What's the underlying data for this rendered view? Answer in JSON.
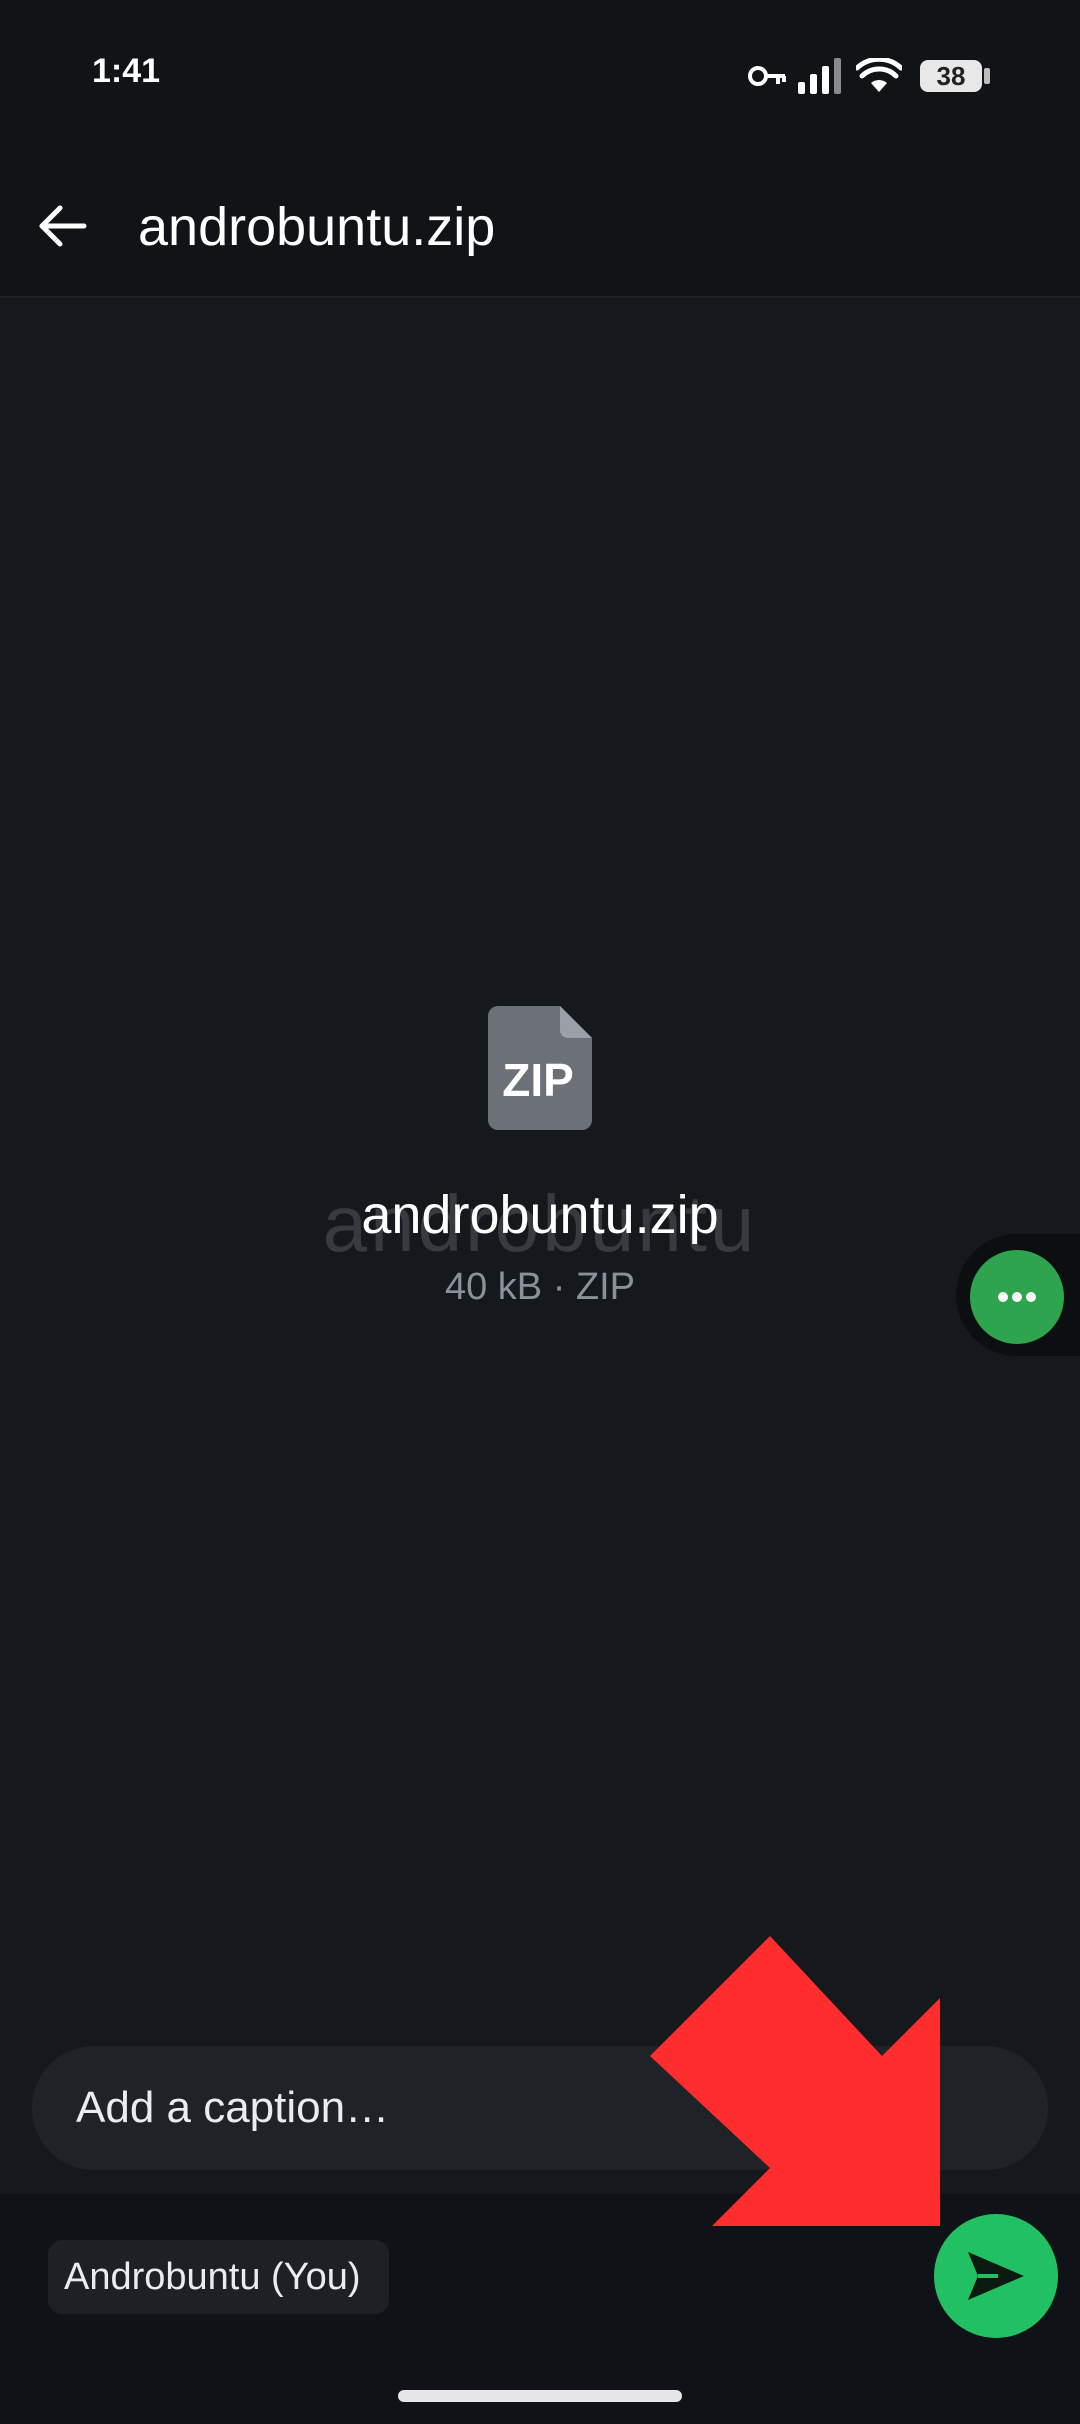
{
  "status_bar": {
    "time": "1:41",
    "battery": "38",
    "icons": [
      "key-icon",
      "signal-icon",
      "wifi-icon",
      "battery-icon"
    ]
  },
  "app_bar": {
    "title": "androbuntu.zip",
    "back_icon": "back-arrow-icon"
  },
  "preview": {
    "file_icon_label": "ZIP",
    "file_name": "androbuntu.zip",
    "file_meta": "40 kB · ZIP",
    "watermark": "androbuntu",
    "more_icon": "more-dots-icon"
  },
  "caption": {
    "placeholder": "Add a caption…"
  },
  "recipient": {
    "label": "Androbuntu (You)"
  },
  "send": {
    "icon": "send-icon"
  },
  "colors": {
    "background": "#15181d",
    "bar": "#111417",
    "accent_green": "#21c063",
    "annotation_red": "#ff2d2d"
  }
}
